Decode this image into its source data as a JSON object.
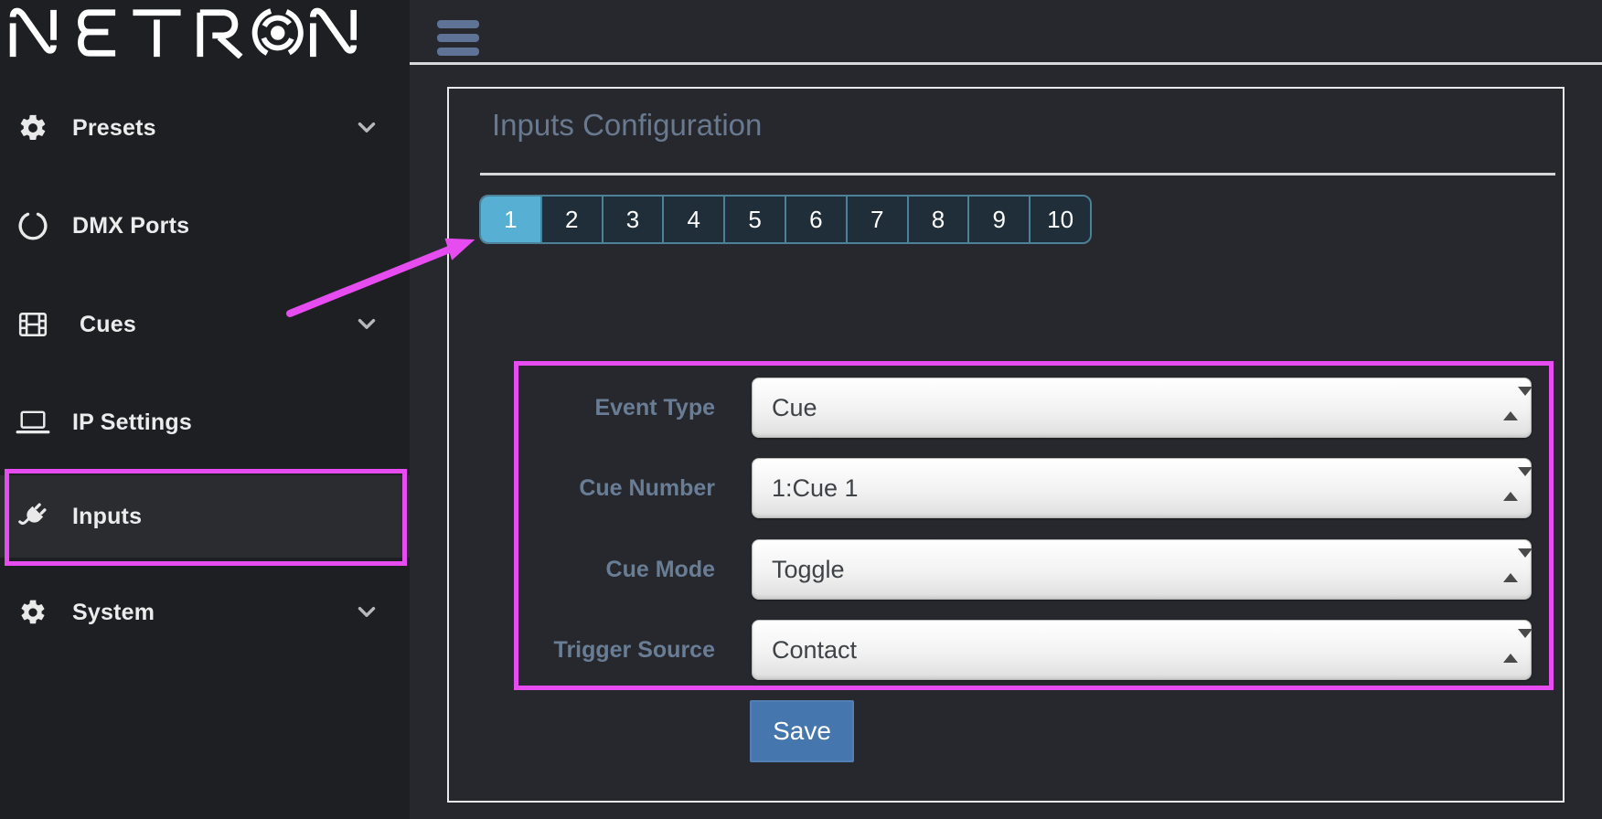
{
  "logo": {
    "text": "NETRON"
  },
  "topbar": {
    "menu_icon": "hamburger"
  },
  "sidebar": {
    "items": [
      {
        "label": "Presets",
        "icon": "gear",
        "expandable": true,
        "active": false
      },
      {
        "label": "DMX Ports",
        "icon": "ring",
        "expandable": false,
        "active": false
      },
      {
        "label": "Cues",
        "icon": "film",
        "expandable": true,
        "active": false
      },
      {
        "label": "IP Settings",
        "icon": "laptop",
        "expandable": false,
        "active": false
      },
      {
        "label": "Inputs",
        "icon": "plug",
        "expandable": false,
        "active": true
      },
      {
        "label": "System",
        "icon": "gear",
        "expandable": true,
        "active": false
      }
    ]
  },
  "panel": {
    "title": "Inputs Configuration",
    "tabs": {
      "selected": "1",
      "items": [
        "1",
        "2",
        "3",
        "4",
        "5",
        "6",
        "7",
        "8",
        "9",
        "10"
      ]
    },
    "form": {
      "rows": [
        {
          "label": "Event Type",
          "value": "Cue"
        },
        {
          "label": "Cue Number",
          "value": "1:Cue 1"
        },
        {
          "label": "Cue Mode",
          "value": "Toggle"
        },
        {
          "label": "Trigger Source",
          "value": "Contact"
        }
      ],
      "save_label": "Save"
    }
  },
  "annotations": {
    "highlight_color": "#E64CF0",
    "highlighted_sidebar_item": "Inputs",
    "arrow_target": "tab 1"
  },
  "colors": {
    "annotation": "#E64CF0",
    "tab_selected": "#58AFD4",
    "save_button": "#4577AE",
    "sidebar_bg": "#1D1F23",
    "main_bg": "#26282D",
    "accent_text": "#69798F"
  }
}
